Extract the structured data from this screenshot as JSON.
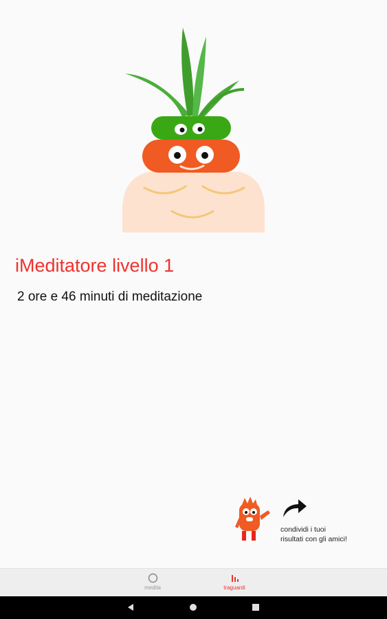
{
  "achievement": {
    "level_title": "iMeditatore livello 1",
    "meditation_time": "2 ore e 46 minuti di meditazione"
  },
  "share": {
    "line1": "condividi i tuoi",
    "line2": "risultati con gli amici!"
  },
  "bottom_nav": {
    "items": [
      {
        "label": "medita",
        "icon": "circle-icon",
        "active": false
      },
      {
        "label": "traguardi",
        "icon": "bar-chart-icon",
        "active": true
      }
    ]
  },
  "system_nav": {
    "icons": [
      "back-triangle-icon",
      "home-circle-icon",
      "recents-square-icon"
    ]
  },
  "colors": {
    "accent": "#f0312e",
    "mascot_orange": "#f05a23",
    "mascot_green": "#3aa815",
    "skin": "#fde2cf"
  }
}
